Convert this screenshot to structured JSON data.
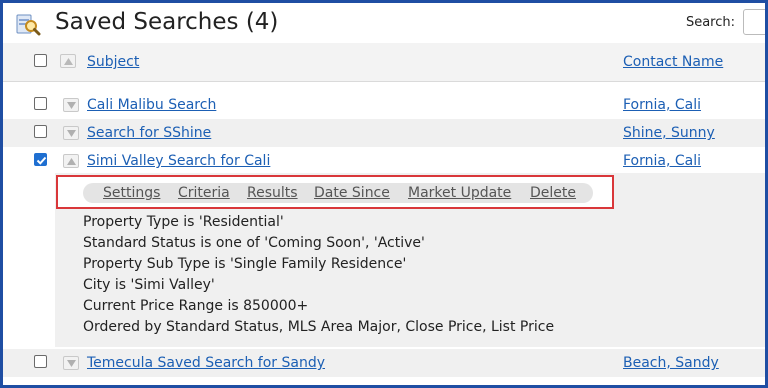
{
  "header": {
    "title": "Saved Searches (4)",
    "search_label": "Search:",
    "search_value": ""
  },
  "columns": {
    "subject": "Subject",
    "contact_name": "Contact Name"
  },
  "rows": [
    {
      "subject": "Cali Malibu Search",
      "contact": "Fornia, Cali",
      "checked": false
    },
    {
      "subject": "Search for SShine",
      "contact": "Shine, Sunny",
      "checked": false
    },
    {
      "subject": "Simi Valley Search for Cali",
      "contact": "Fornia, Cali",
      "checked": true
    },
    {
      "subject": "Temecula Saved Search for Sandy",
      "contact": "Beach, Sandy",
      "checked": false
    }
  ],
  "actions": [
    "Settings",
    "Criteria",
    "Results",
    "Date Since",
    "Market Update",
    "Delete"
  ],
  "criteria": [
    "Property Type is 'Residential'",
    "Standard Status is one of 'Coming Soon', 'Active'",
    "Property Sub Type is 'Single Family Residence'",
    "City is 'Simi Valley'",
    "Current Price Range is 850000+",
    "Ordered by Standard Status, MLS Area Major, Close Price, List Price"
  ],
  "colors": {
    "frame": "#1f4ea3",
    "link": "#1c5fb4",
    "highlight": "#d9373a",
    "checkbox_checked": "#1f6fd1"
  },
  "icons": {
    "app": "saved-search-icon",
    "sort": "sort-up-icon",
    "expand": "chevron-down-icon",
    "collapse": "chevron-up-icon"
  }
}
